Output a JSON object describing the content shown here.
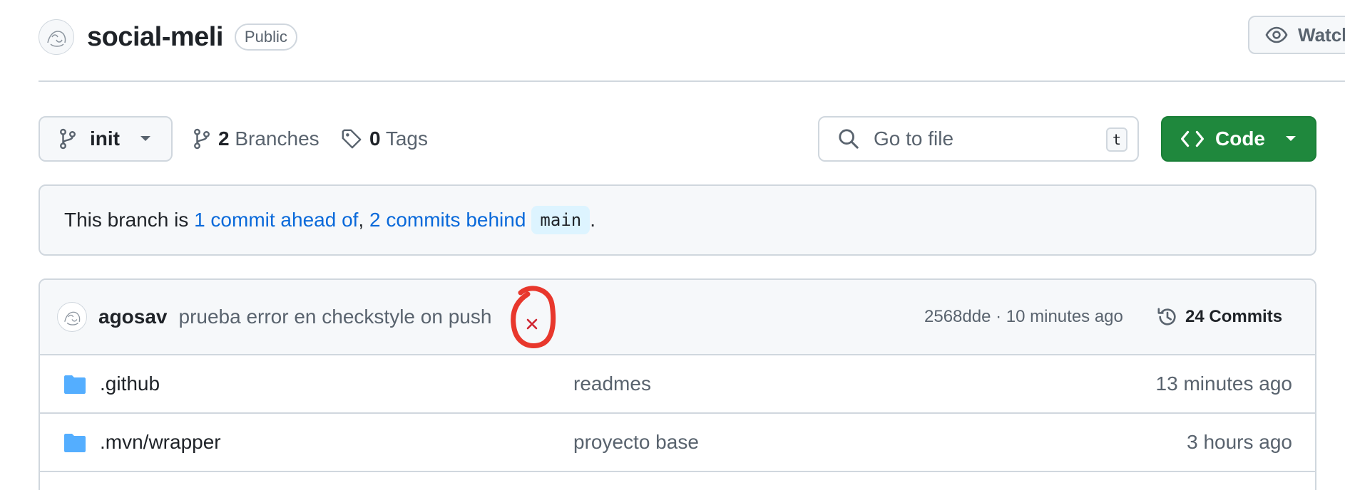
{
  "repo": {
    "name": "social-meli",
    "visibility": "Public",
    "watch_label": "Watch"
  },
  "toolbar": {
    "branch": "init",
    "branches_count": "2",
    "branches_label": "Branches",
    "tags_count": "0",
    "tags_label": "Tags",
    "goto_placeholder": "Go to file",
    "goto_shortcut": "t",
    "code_label": "Code"
  },
  "banner": {
    "prefix": "This branch is ",
    "ahead": "1 commit ahead of",
    "sep": ", ",
    "behind": "2 commits behind",
    "base": "main",
    "suffix": "."
  },
  "commit": {
    "author": "agosav",
    "message": "prueba error en checkstyle on push",
    "status": "failure",
    "hash": "2568dde",
    "sep": " · ",
    "time": "10 minutes ago",
    "count_label": "24 Commits"
  },
  "files": [
    {
      "name": ".github",
      "commit": "readmes",
      "time": "13 minutes ago",
      "icon": "folder-icon"
    },
    {
      "name": ".mvn/wrapper",
      "commit": "proyecto base",
      "time": "3 hours ago",
      "icon": "folder-icon"
    }
  ],
  "colors": {
    "accent": "#0969da",
    "code_button": "#1f883d",
    "folder": "#54aeff",
    "failure": "#cf222e",
    "annotation": "#e8372c"
  }
}
